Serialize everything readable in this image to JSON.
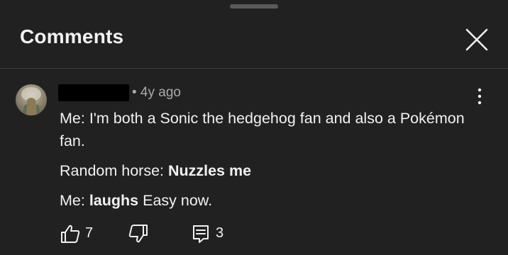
{
  "header": {
    "title": "Comments"
  },
  "comment": {
    "timestamp": "• 4y ago",
    "lines": [
      {
        "plain": "Me: I'm both a Sonic the hedgehog fan and also a Pokémon fan."
      },
      {
        "prefix": "Random horse: ",
        "bold": "Nuzzles me"
      },
      {
        "prefix": "Me: ",
        "bold": "laughs",
        "suffix": " Easy now."
      }
    ],
    "likes": "7",
    "replies": "3"
  },
  "icons": {
    "close": "close-icon",
    "more": "more-vert-icon",
    "like": "thumb-up-icon",
    "dislike": "thumb-down-icon",
    "reply": "reply-icon"
  },
  "colors": {
    "background": "#212121",
    "text": "#f1f1f1",
    "secondary_text": "#aaaaaa"
  }
}
